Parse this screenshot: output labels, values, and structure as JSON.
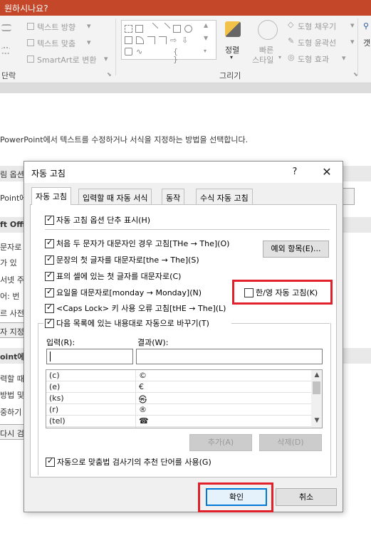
{
  "app": {
    "title_fragment": "원하시나요?",
    "ribbon": {
      "text_direction": "텍스트 방향",
      "text_align": "텍스트 맞춤",
      "smartart": "SmartArt로 변환",
      "paragraph_group": "단락",
      "arrange": "정렬",
      "quick_styles": "빠른",
      "quick_styles_2": "스타일",
      "shape_fill": "도형 채우기",
      "shape_outline": "도형 윤곽선",
      "shape_effects": "도형 효과",
      "drawing_group": "그리기",
      "edge_fragment": "갯"
    },
    "background": {
      "description": "PowerPoint에서 텍스트를 수정하거나 서식을 지정하는 방법을 선택합니다.",
      "fragments": [
        "림 옵션",
        "Point에",
        "ft Offi",
        "문자로",
        "가 있",
        "서넷 주",
        "어: 번",
        "르 사전",
        "자 지정",
        "oint에서",
        "력할 때",
        "방법 및",
        "중하기",
        "다시 검"
      ]
    }
  },
  "dialog": {
    "title": "자동 고침",
    "help": "?",
    "close": "✕",
    "tabs": [
      "자동 고침",
      "입력할 때 자동 서식",
      "동작",
      "수식 자동 고침"
    ],
    "show_options_buttons": "자동 고침 옵션 단추 표시(H)",
    "options": [
      {
        "label": "처음 두 문자가 대문자인 경우 고침[THe → The](O)",
        "checked": true
      },
      {
        "label": "문장의 첫 글자를 대문자로[the → The](S)",
        "checked": true
      },
      {
        "label": "표의 셀에 있는 첫 글자를 대문자로(C)",
        "checked": true
      },
      {
        "label": "요일을 대문자로[monday → Monday](N)",
        "checked": true
      },
      {
        "label": "<Caps Lock> 키 사용 오류 고침[tHE → The](L)",
        "checked": true
      },
      {
        "label": "다음 목록에 있는 내용대로 자동으로 바꾸기(T)",
        "checked": true
      }
    ],
    "exceptions_button": "예외 항목(E)...",
    "korean_english": {
      "label": "한/영 자동 고침(K)",
      "checked": false
    },
    "replace_label": "입력(R):",
    "with_label": "결과(W):",
    "replace_value": "",
    "with_value": "",
    "list": [
      {
        "input": "(c)",
        "result": "©"
      },
      {
        "input": "(e)",
        "result": "€"
      },
      {
        "input": "(ks)",
        "result": "㉿"
      },
      {
        "input": "(r)",
        "result": "®"
      },
      {
        "input": "(tel)",
        "result": "☎"
      }
    ],
    "add_button": "추가(A)",
    "delete_button": "삭제(D)",
    "spellcheck_option": {
      "label": "자동으로 맞춤법 검사기의 추천 단어를 사용(G)",
      "checked": true
    },
    "ok_button": "확인",
    "cancel_button": "취소"
  },
  "colors": {
    "title_bar": "#c4472a",
    "highlight": "#e0202a",
    "focus": "#0078d7"
  }
}
